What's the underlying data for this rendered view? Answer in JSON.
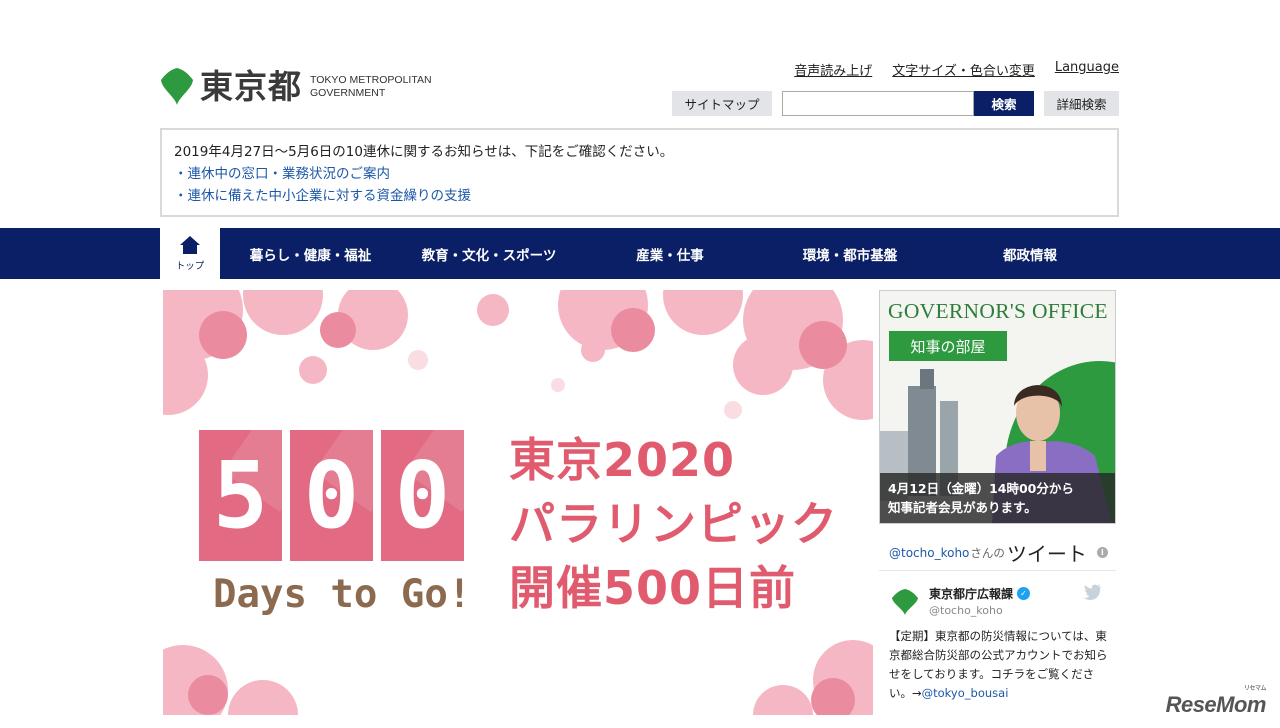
{
  "header": {
    "logo_jp": "東京都",
    "logo_en_line1": "TOKYO METROPOLITAN",
    "logo_en_line2": "GOVERNMENT",
    "util_links": [
      "音声読み上げ",
      "文字サイズ・色合い変更",
      "Language"
    ],
    "sitemap_label": "サイトマップ",
    "search_placeholder": "",
    "search_label": "検索",
    "advanced_search_label": "詳細検索"
  },
  "notice": {
    "text": "2019年4月27日～5月6日の10連休に関するお知らせは、下記をご確認ください。",
    "links": [
      "・連休中の窓口・業務状況のご案内",
      "・連休に備えた中小企業に対する資金繰りの支援"
    ]
  },
  "nav": {
    "home_label": "トップ",
    "items": [
      "暮らし・健康・福祉",
      "教育・文化・スポーツ",
      "産業・仕事",
      "環境・都市基盤",
      "都政情報"
    ]
  },
  "hero": {
    "digits": [
      "5",
      "0",
      "0"
    ],
    "days_text": "Days to Go!",
    "title_lines": [
      "東京2020",
      "パラリンピック",
      "開催500日前"
    ]
  },
  "governor": {
    "title": "GOVERNOR'S OFFICE",
    "subtitle": "知事の部屋",
    "caption_line1": "4月12日（金曜）14時00分から",
    "caption_line2": "知事記者会見があります。"
  },
  "twitter": {
    "handle": "@tocho_koho",
    "san": "さんの",
    "label": "ツイート",
    "account_name": "東京都庁広報課",
    "screen_name": "@tocho_koho",
    "tweet_text": "【定期】東京都の防災情報については、東京都総合防災部の公式アカウントでお知らせをしております。コチラをご覧ください。→",
    "tweet_mention": "@tokyo_bousai"
  },
  "watermark": {
    "text": "ReseMom",
    "small": "リセマム"
  },
  "colors": {
    "nav_bg": "#0a1f66",
    "link": "#1c58a8",
    "hero_pink": "#e26b83",
    "hero_title": "#e15b6f",
    "days_brown": "#8b6a4f",
    "governor_green": "#2e7d3b",
    "tokyo_green": "#2e9a3f"
  }
}
